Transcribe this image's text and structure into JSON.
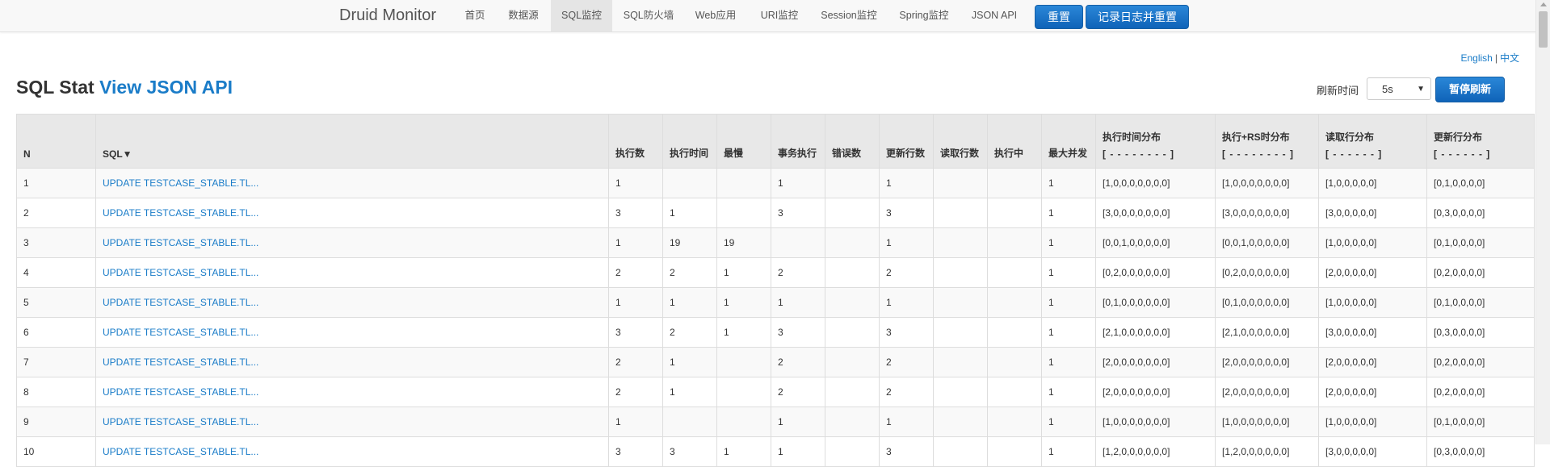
{
  "nav": {
    "brand": "Druid Monitor",
    "items": [
      "首页",
      "数据源",
      "SQL监控",
      "SQL防火墙",
      "Web应用",
      "URI监控",
      "Session监控",
      "Spring监控",
      "JSON API"
    ],
    "active_index": 2,
    "reset_button": "重置",
    "log_reset_button": "记录日志并重置"
  },
  "lang": {
    "english": "English",
    "separator": "|",
    "chinese": "中文"
  },
  "title": {
    "prefix": "SQL Stat",
    "link": "View JSON API"
  },
  "refresh": {
    "label": "刷新时间",
    "value": "5s",
    "pause_button": "暂停刷新"
  },
  "table": {
    "headers": [
      {
        "label": "N"
      },
      {
        "label": "SQL▼"
      },
      {
        "label": "执行数"
      },
      {
        "label": "执行时间"
      },
      {
        "label": "最慢"
      },
      {
        "label": "事务执行"
      },
      {
        "label": "错误数"
      },
      {
        "label": "更新行数"
      },
      {
        "label": "读取行数"
      },
      {
        "label": "执行中"
      },
      {
        "label": "最大并发"
      },
      {
        "label": "执行时间分布",
        "sub": "[ - - - - - - - - ]"
      },
      {
        "label": "执行+RS时分布",
        "sub": "[ - - - - - - - - ]"
      },
      {
        "label": "读取行分布",
        "sub": "[ - - - - - - ]"
      },
      {
        "label": "更新行分布",
        "sub": "[ - - - - - - ]"
      }
    ],
    "rows": [
      [
        "1",
        "UPDATE TESTCASE_STABLE.TL...",
        "1",
        "",
        "",
        "1",
        "",
        "1",
        "",
        "",
        "1",
        "[1,0,0,0,0,0,0,0]",
        "[1,0,0,0,0,0,0,0]",
        "[1,0,0,0,0,0]",
        "[0,1,0,0,0,0]"
      ],
      [
        "2",
        "UPDATE TESTCASE_STABLE.TL...",
        "3",
        "1",
        "",
        "3",
        "",
        "3",
        "",
        "",
        "1",
        "[3,0,0,0,0,0,0,0]",
        "[3,0,0,0,0,0,0,0]",
        "[3,0,0,0,0,0]",
        "[0,3,0,0,0,0]"
      ],
      [
        "3",
        "UPDATE TESTCASE_STABLE.TL...",
        "1",
        "19",
        "19",
        "",
        "",
        "1",
        "",
        "",
        "1",
        "[0,0,1,0,0,0,0,0]",
        "[0,0,1,0,0,0,0,0]",
        "[1,0,0,0,0,0]",
        "[0,1,0,0,0,0]"
      ],
      [
        "4",
        "UPDATE TESTCASE_STABLE.TL...",
        "2",
        "2",
        "1",
        "2",
        "",
        "2",
        "",
        "",
        "1",
        "[0,2,0,0,0,0,0,0]",
        "[0,2,0,0,0,0,0,0]",
        "[2,0,0,0,0,0]",
        "[0,2,0,0,0,0]"
      ],
      [
        "5",
        "UPDATE TESTCASE_STABLE.TL...",
        "1",
        "1",
        "1",
        "1",
        "",
        "1",
        "",
        "",
        "1",
        "[0,1,0,0,0,0,0,0]",
        "[0,1,0,0,0,0,0,0]",
        "[1,0,0,0,0,0]",
        "[0,1,0,0,0,0]"
      ],
      [
        "6",
        "UPDATE TESTCASE_STABLE.TL...",
        "3",
        "2",
        "1",
        "3",
        "",
        "3",
        "",
        "",
        "1",
        "[2,1,0,0,0,0,0,0]",
        "[2,1,0,0,0,0,0,0]",
        "[3,0,0,0,0,0]",
        "[0,3,0,0,0,0]"
      ],
      [
        "7",
        "UPDATE TESTCASE_STABLE.TL...",
        "2",
        "1",
        "",
        "2",
        "",
        "2",
        "",
        "",
        "1",
        "[2,0,0,0,0,0,0,0]",
        "[2,0,0,0,0,0,0,0]",
        "[2,0,0,0,0,0]",
        "[0,2,0,0,0,0]"
      ],
      [
        "8",
        "UPDATE TESTCASE_STABLE.TL...",
        "2",
        "1",
        "",
        "2",
        "",
        "2",
        "",
        "",
        "1",
        "[2,0,0,0,0,0,0,0]",
        "[2,0,0,0,0,0,0,0]",
        "[2,0,0,0,0,0]",
        "[0,2,0,0,0,0]"
      ],
      [
        "9",
        "UPDATE TESTCASE_STABLE.TL...",
        "1",
        "",
        "",
        "1",
        "",
        "1",
        "",
        "",
        "1",
        "[1,0,0,0,0,0,0,0]",
        "[1,0,0,0,0,0,0,0]",
        "[1,0,0,0,0,0]",
        "[0,1,0,0,0,0]"
      ],
      [
        "10",
        "UPDATE TESTCASE_STABLE.TL...",
        "3",
        "3",
        "1",
        "1",
        "",
        "3",
        "",
        "",
        "1",
        "[1,2,0,0,0,0,0,0]",
        "[1,2,0,0,0,0,0,0]",
        "[3,0,0,0,0,0]",
        "[0,3,0,0,0,0]"
      ]
    ]
  }
}
